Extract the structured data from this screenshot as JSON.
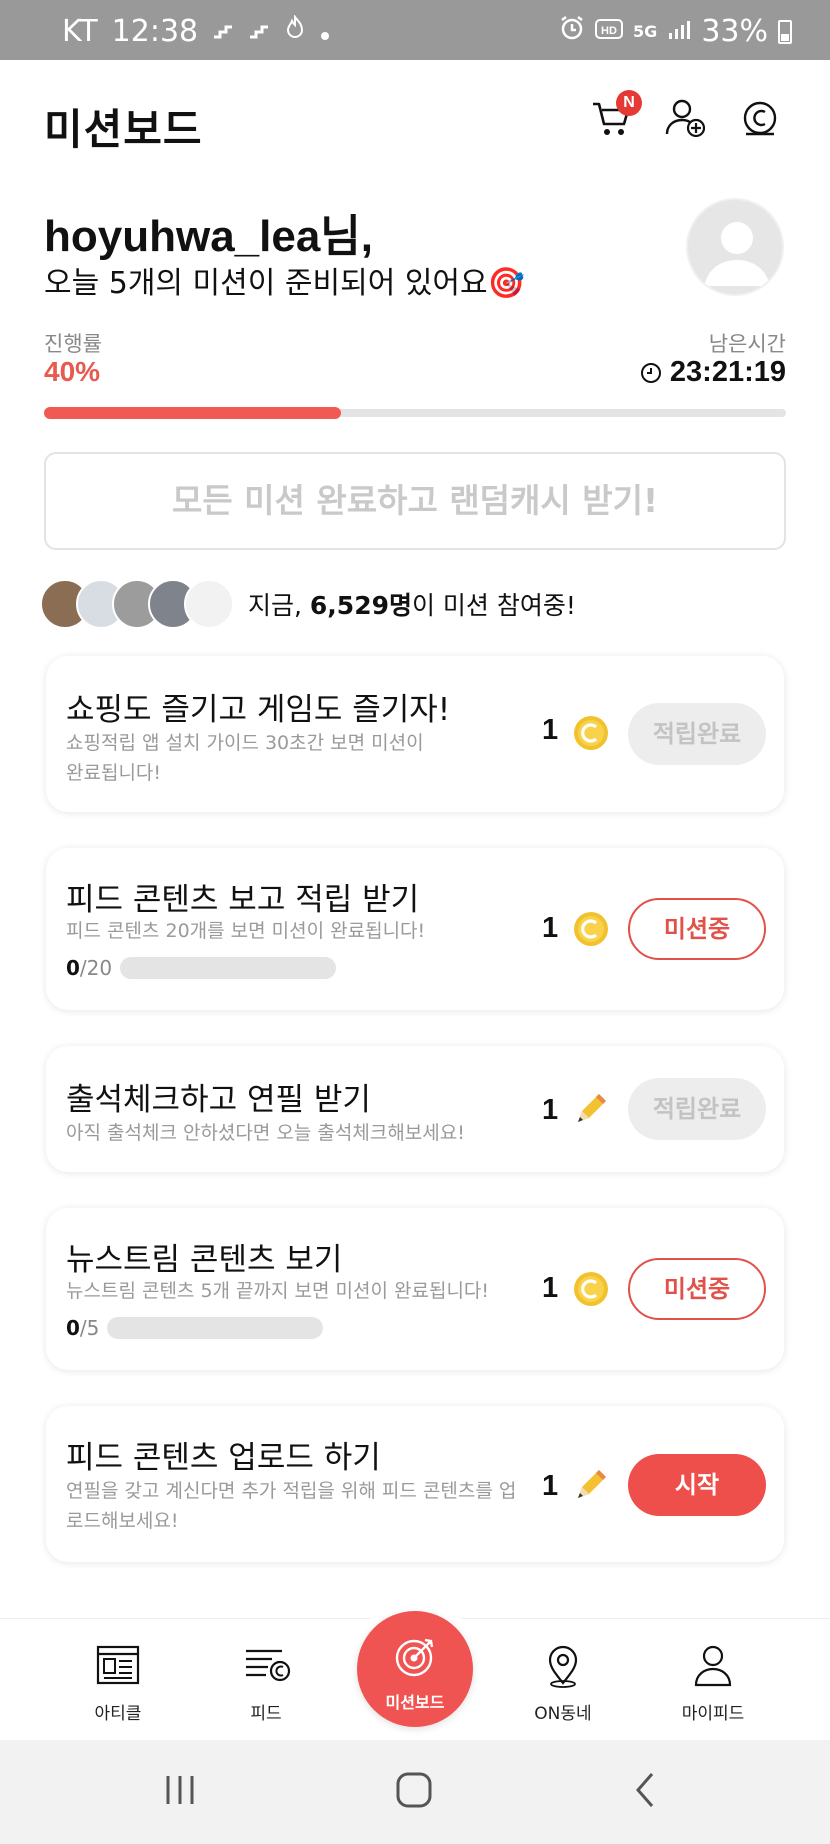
{
  "status_bar": {
    "carrier": "KT",
    "time": "12:38",
    "network": "5G",
    "battery": "33%"
  },
  "header": {
    "title": "미션보드",
    "cart_badge": "N",
    "icons": [
      "cart-icon",
      "add-user-icon",
      "cash-icon"
    ]
  },
  "greeting": {
    "username": "hoyuhwa_lea님,",
    "subtitle": "오늘 5개의 미션이 준비되어 있어요🎯"
  },
  "progress": {
    "label": "진행률",
    "value": "40%",
    "fraction": 0.4,
    "time_label": "남은시간",
    "time_value": "23:21:19"
  },
  "reward_banner": "모든 미션 완료하고 랜덤캐시 받기!",
  "participants": {
    "prefix": "지금, ",
    "count": "6,529명",
    "suffix": "이 미션 참여중!"
  },
  "missions": [
    {
      "title": "쇼핑도 즐기고 게임도 즐기자!",
      "desc": "쇼핑적립 앱 설치 가이드 30초간 보면 미션이 완료됩니다!",
      "reward": "1",
      "reward_icon": "coin-icon",
      "button": "적립완료",
      "state": "done"
    },
    {
      "title": "피드 콘텐츠 보고 적립 받기",
      "desc": "피드 콘텐츠 20개를 보면 미션이 완료됩니다!",
      "count_current": "0",
      "count_total": "/20",
      "reward": "1",
      "reward_icon": "coin-icon",
      "button": "미션중",
      "state": "doing"
    },
    {
      "title": "출석체크하고 연필 받기",
      "desc": "아직 출석체크 안하셨다면 오늘 출석체크해보세요!",
      "reward": "1",
      "reward_icon": "pencil-icon",
      "button": "적립완료",
      "state": "done"
    },
    {
      "title": "뉴스트림 콘텐츠 보기",
      "desc": "뉴스트림 콘텐츠 5개 끝까지 보면 미션이 완료됩니다!",
      "count_current": "0",
      "count_total": "/5",
      "reward": "1",
      "reward_icon": "coin-icon",
      "button": "미션중",
      "state": "doing"
    },
    {
      "title": "피드 콘텐츠 업로드 하기",
      "desc": "연필을 갖고 계신다면 추가 적립을 위해 피드 콘텐츠를 업로드해보세요!",
      "reward": "1",
      "reward_icon": "pencil-icon",
      "button": "시작",
      "state": "start"
    }
  ],
  "bottom_nav": {
    "items": [
      {
        "label": "아티클",
        "icon": "article-icon"
      },
      {
        "label": "피드",
        "icon": "feed-icon"
      },
      {
        "label": "미션보드",
        "icon": "target-icon"
      },
      {
        "label": "ON동네",
        "icon": "location-icon"
      },
      {
        "label": "마이피드",
        "icon": "person-icon"
      }
    ]
  },
  "colors": {
    "accent": "#f05452",
    "status_bar": "#999999",
    "disabled": "#c3c3c3"
  }
}
